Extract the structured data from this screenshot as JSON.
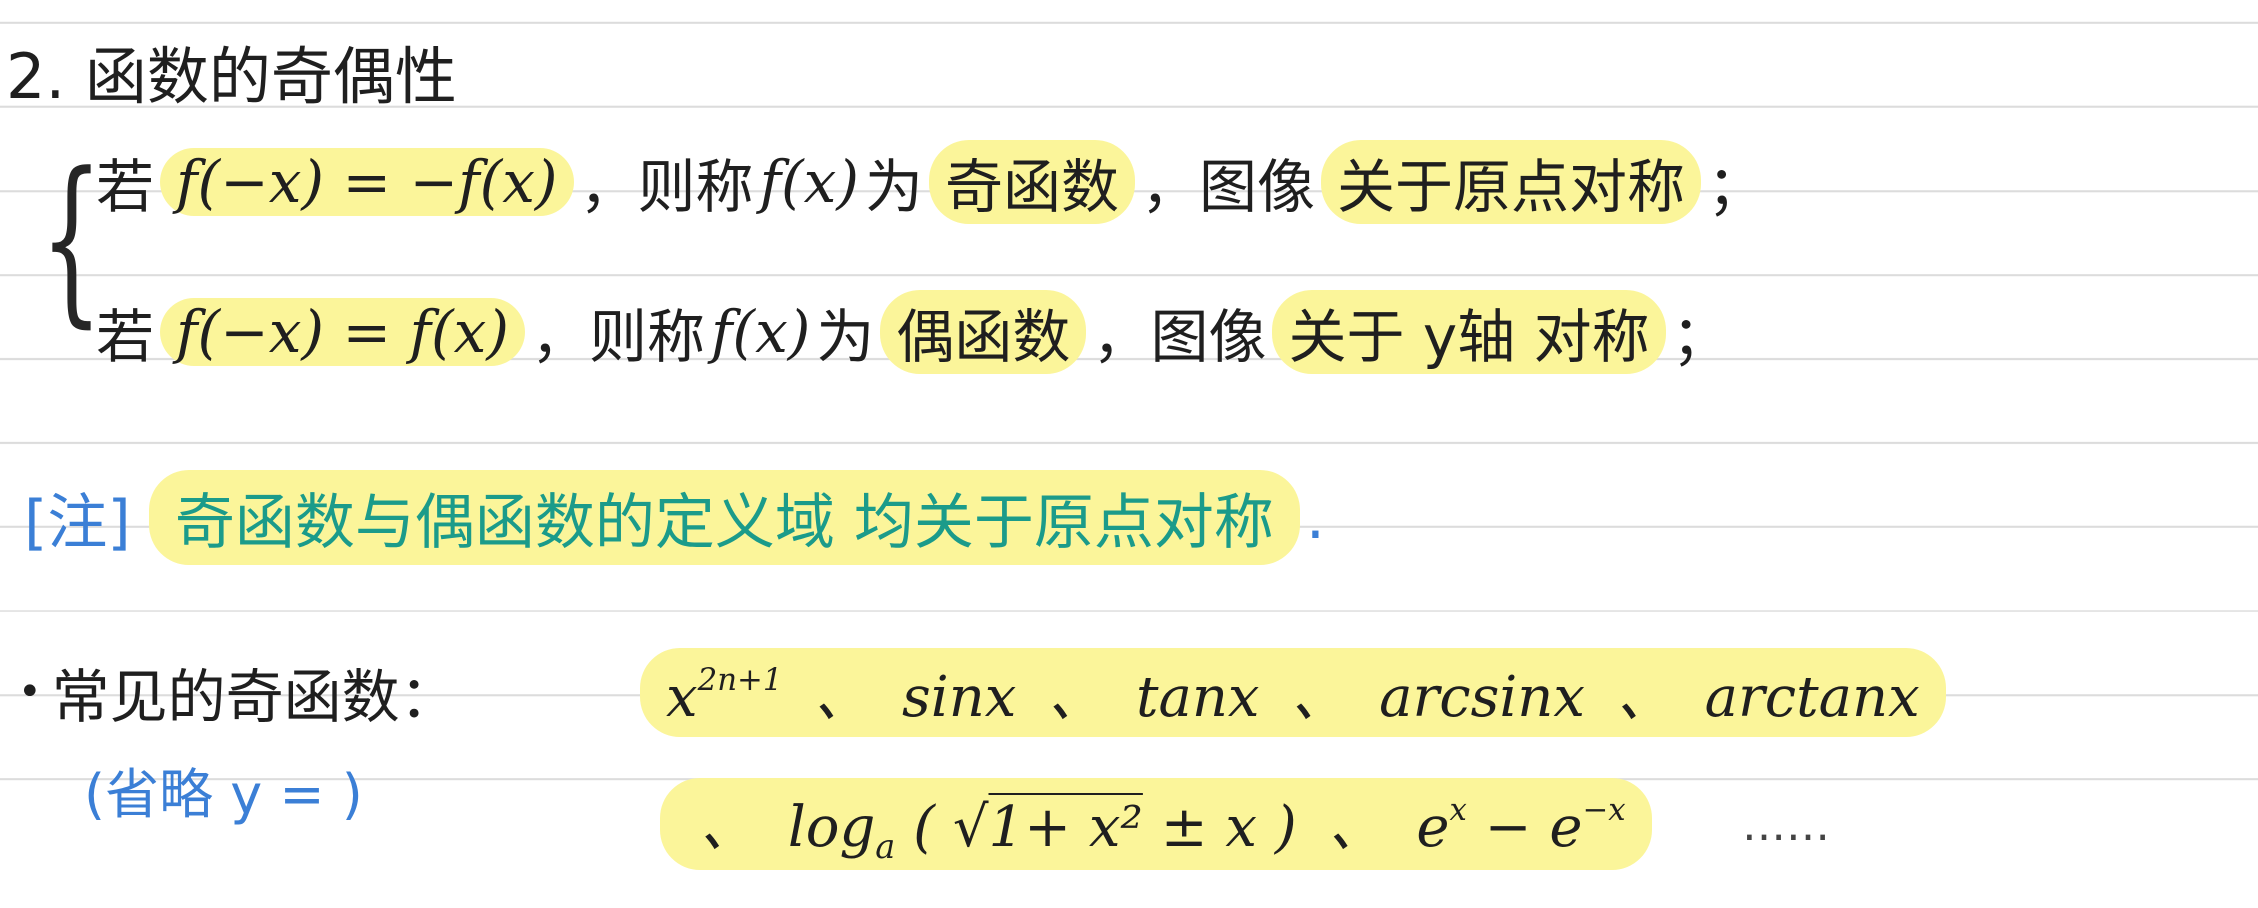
{
  "heading": "2. 函数的奇偶性",
  "definitions": [
    {
      "prefix": "若",
      "condition": "f(−x) = −f(x)",
      "mid1": "，则称",
      "fx": "f(x)",
      "mid2": "为",
      "type": "奇函数",
      "mid3": "，图像",
      "symmetry": "关于原点对称",
      "end": "；"
    },
    {
      "prefix": "若",
      "condition": "f(−x) = f(x)",
      "mid1": "，则称",
      "fx": "f(x)",
      "mid2": "为",
      "type": "偶函数",
      "mid3": "，图像",
      "symmetry": "关于 y轴 对称",
      "end": "；"
    }
  ],
  "note": {
    "tag": "[注]",
    "text": "奇函数与偶函数的定义域 均关于原点对称",
    "end": "."
  },
  "common": {
    "bullet": "•",
    "label": "常见的奇函数：",
    "aside": "(省略 y = )",
    "row1": {
      "x_base": "x",
      "x_exp": "2n+1",
      "sep": "、",
      "sin": "sinx",
      "tan": "tanx",
      "arcsin": "arcsinx",
      "arctan": "arctanx"
    },
    "row2": {
      "lead": "、",
      "log": "log",
      "log_base": "a",
      "paren_open": "(",
      "sqrt_sym": "√",
      "radicand": "1+ x²",
      "pm": "± x",
      "paren_close": ")",
      "sep": "、",
      "e1": "e",
      "e1_exp": "x",
      "minus": " − ",
      "e2": "e",
      "e2_exp": "−x"
    },
    "ellipsis": "……"
  },
  "colors": {
    "highlight": "#fbf59a",
    "blue": "#3b7fd6",
    "teal": "#1b9b8a",
    "ink": "#1f1f1f"
  }
}
